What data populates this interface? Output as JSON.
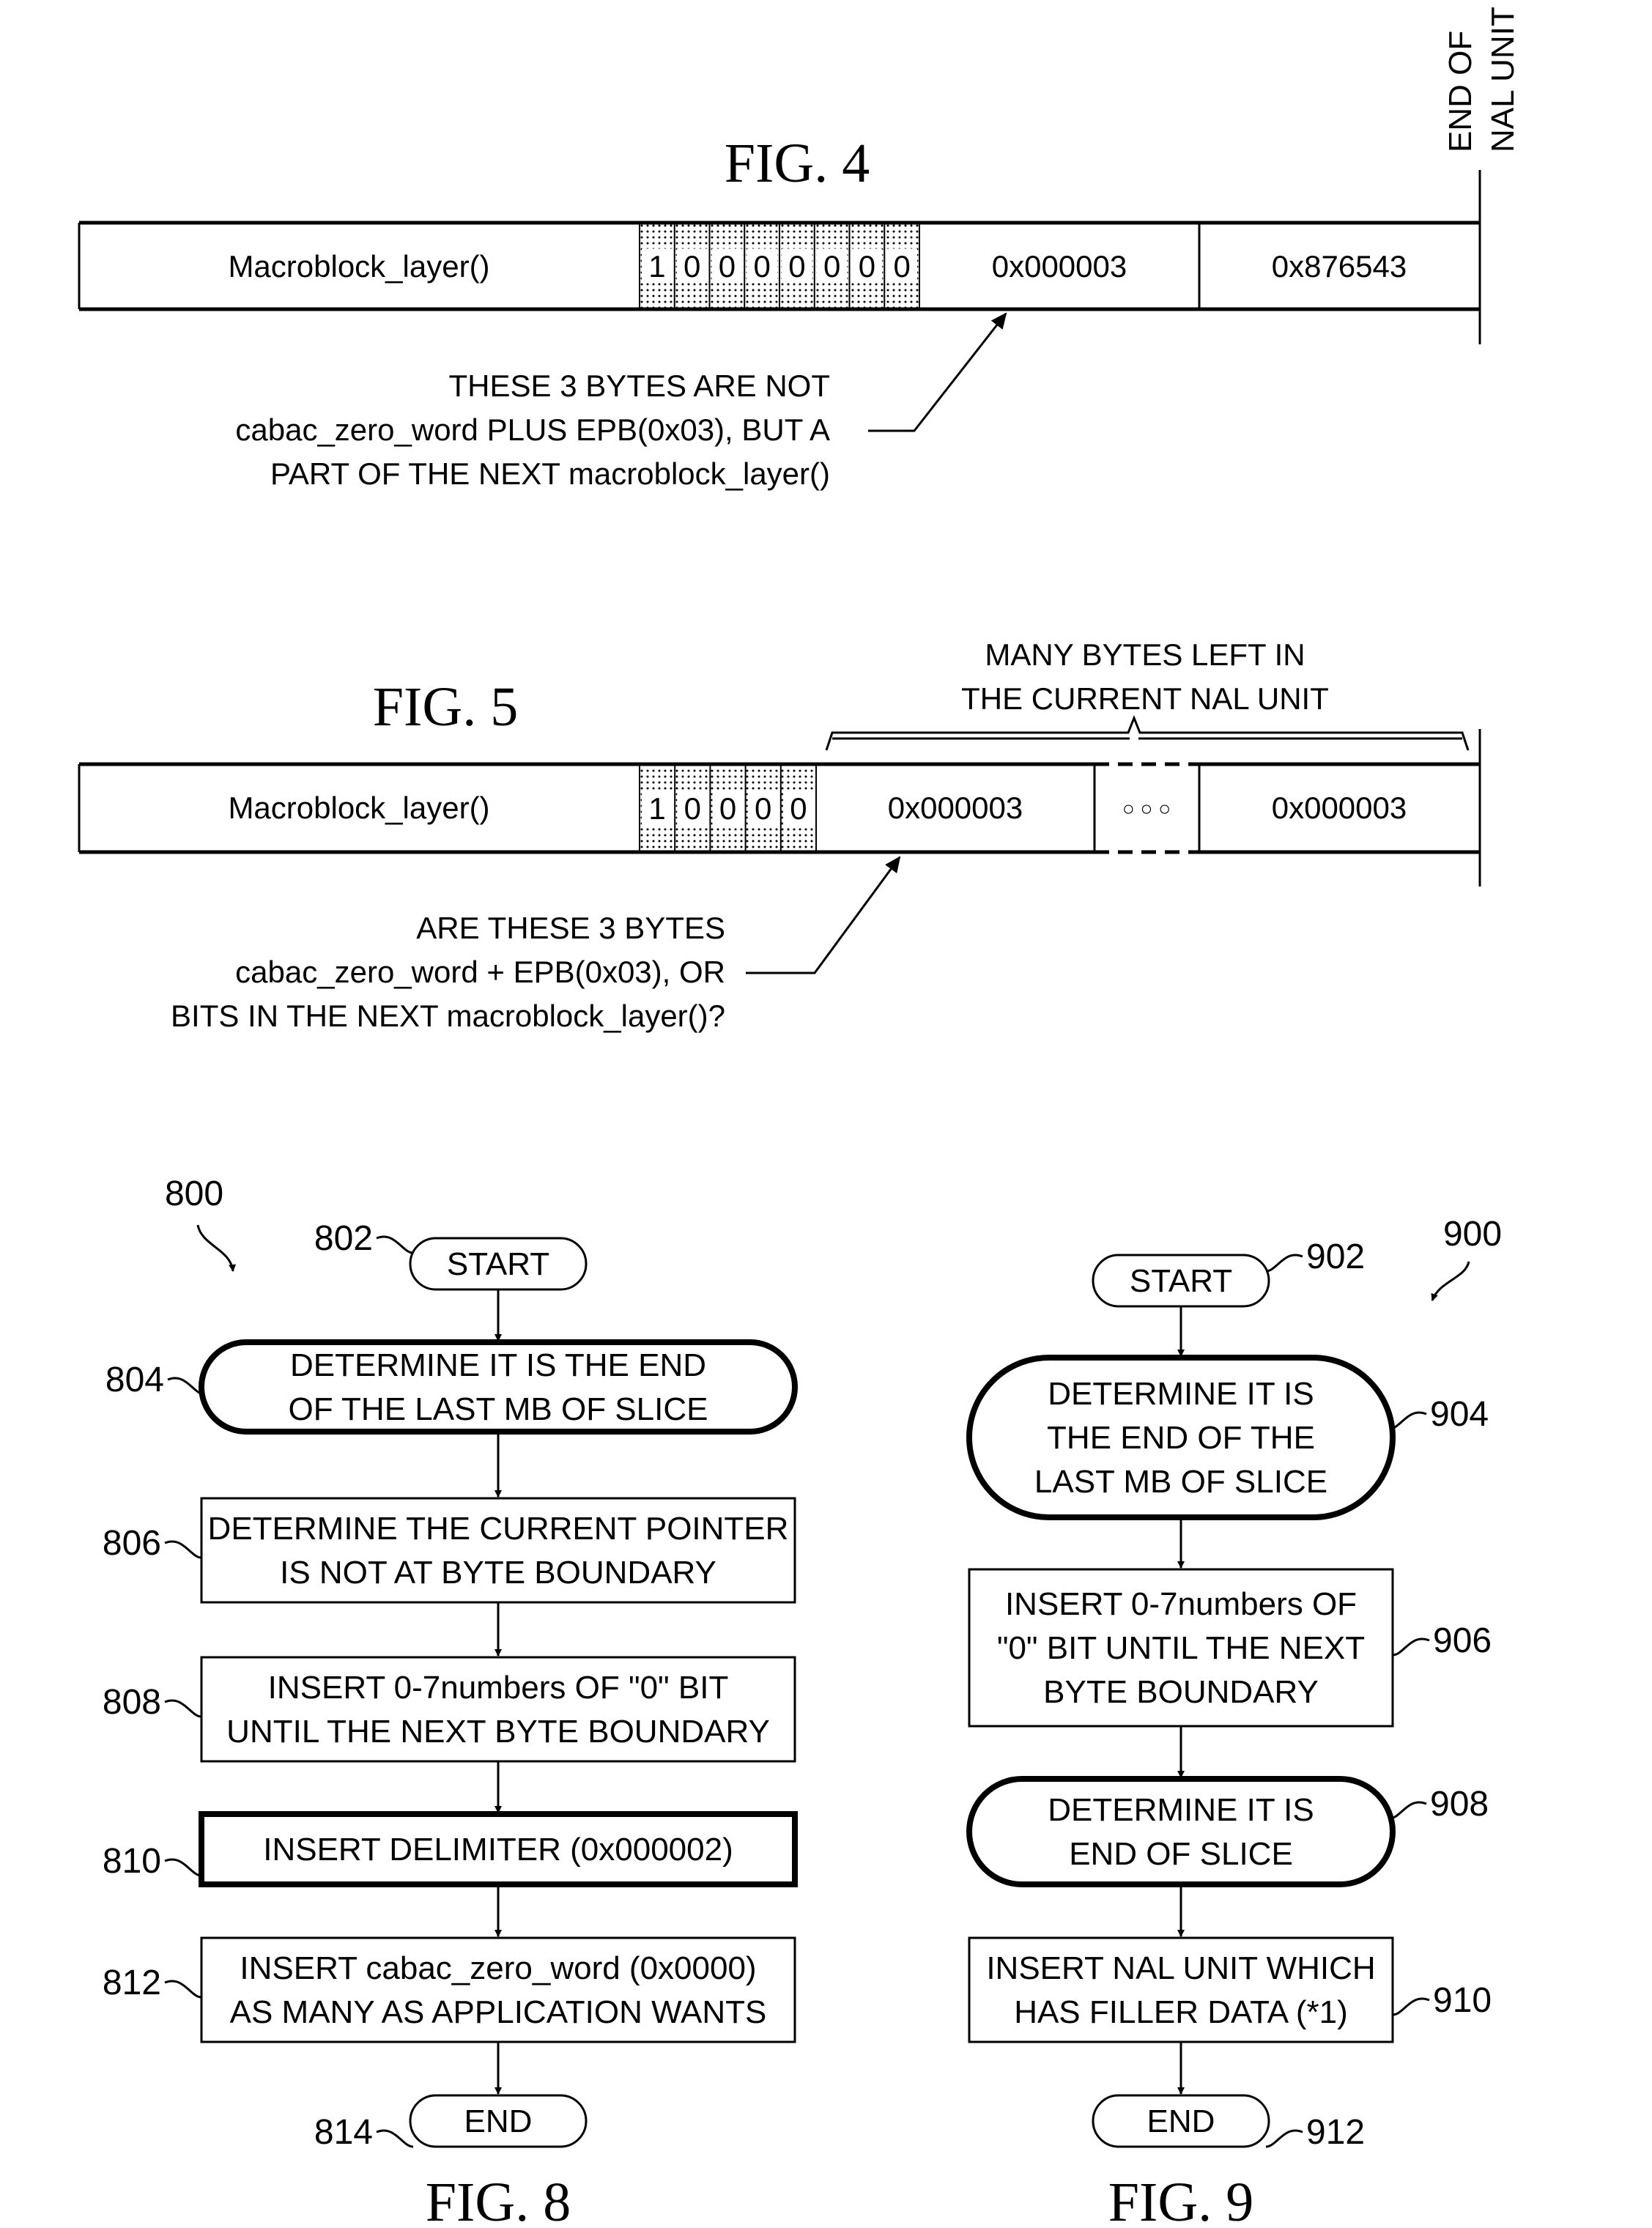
{
  "fig4": {
    "title": "FIG. 4",
    "cells": {
      "macroblock": "Macroblock_layer()",
      "bits": [
        "1",
        "0",
        "0",
        "0",
        "0",
        "0",
        "0",
        "0"
      ],
      "bytes1": "0x000003",
      "bytes2": "0x876543"
    },
    "end_label": [
      "END OF",
      "NAL UNIT"
    ],
    "annotation": [
      "THESE 3 BYTES ARE NOT",
      "cabac_zero_word PLUS EPB(0x03), BUT A",
      "PART OF THE NEXT macroblock_layer()"
    ]
  },
  "fig5": {
    "title": "FIG. 5",
    "cells": {
      "macroblock": "Macroblock_layer()",
      "bits": [
        "1",
        "0",
        "0",
        "0",
        "0"
      ],
      "bytes1": "0x000003",
      "ellipsis": "○ ○ ○",
      "bytes2": "0x000003"
    },
    "brace_label": [
      "MANY BYTES LEFT IN",
      "THE CURRENT NAL UNIT"
    ],
    "annotation": [
      "ARE THESE 3 BYTES",
      "cabac_zero_word + EPB(0x03), OR",
      "BITS IN THE NEXT macroblock_layer()?"
    ]
  },
  "fig8": {
    "title": "FIG. 8",
    "ref": "800",
    "steps": [
      {
        "ref": "802",
        "shape": "terminal",
        "lines": [
          "START"
        ]
      },
      {
        "ref": "804",
        "shape": "decision",
        "lines": [
          "DETERMINE IT IS THE END",
          "OF THE LAST MB OF SLICE"
        ]
      },
      {
        "ref": "806",
        "shape": "process",
        "lines": [
          "DETERMINE THE CURRENT POINTER",
          "IS NOT AT BYTE BOUNDARY"
        ]
      },
      {
        "ref": "808",
        "shape": "process",
        "lines": [
          "INSERT 0-7numbers OF \"0\" BIT",
          "UNTIL THE NEXT BYTE BOUNDARY"
        ]
      },
      {
        "ref": "810",
        "shape": "process-bold",
        "lines": [
          "INSERT DELIMITER (0x000002)"
        ]
      },
      {
        "ref": "812",
        "shape": "process",
        "lines": [
          "INSERT cabac_zero_word (0x0000)",
          "AS MANY AS APPLICATION WANTS"
        ]
      },
      {
        "ref": "814",
        "shape": "terminal",
        "lines": [
          "END"
        ]
      }
    ]
  },
  "fig9": {
    "title": "FIG. 9",
    "ref": "900",
    "steps": [
      {
        "ref": "902",
        "shape": "terminal",
        "lines": [
          "START"
        ]
      },
      {
        "ref": "904",
        "shape": "decision",
        "lines": [
          "DETERMINE IT IS",
          "THE END OF THE",
          "LAST MB OF SLICE"
        ]
      },
      {
        "ref": "906",
        "shape": "process",
        "lines": [
          "INSERT 0-7numbers OF",
          "\"0\" BIT UNTIL THE NEXT",
          "BYTE BOUNDARY"
        ]
      },
      {
        "ref": "908",
        "shape": "decision",
        "lines": [
          "DETERMINE IT IS",
          "END OF SLICE"
        ]
      },
      {
        "ref": "910",
        "shape": "process",
        "lines": [
          "INSERT NAL UNIT WHICH",
          "HAS FILLER DATA (*1)"
        ]
      },
      {
        "ref": "912",
        "shape": "terminal",
        "lines": [
          "END"
        ]
      }
    ]
  }
}
